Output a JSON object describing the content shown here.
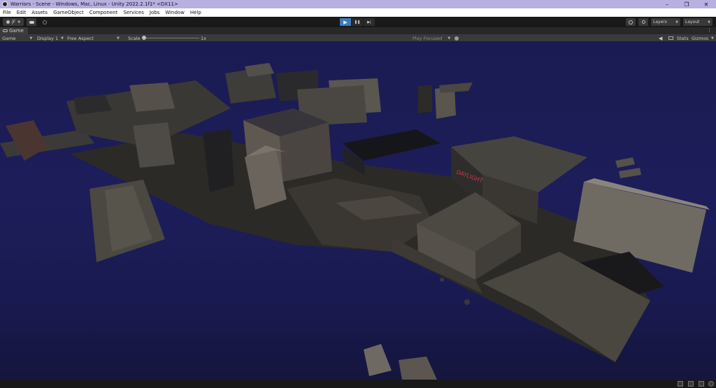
{
  "window": {
    "title": "Warriors - Scene - Windows, Mac, Linux - Unity 2022.2.1f1* <DX11>",
    "minimize": "–",
    "maximize": "❐",
    "close": "✕"
  },
  "menu": [
    "File",
    "Edit",
    "Assets",
    "GameObject",
    "Component",
    "Services",
    "Jobs",
    "Window",
    "Help"
  ],
  "toolbar": {
    "account": "JF",
    "layers": "Layers",
    "layout": "Layout",
    "play_glyph": "▶",
    "pause_glyph": "❚❚",
    "step_glyph": "▶|"
  },
  "tab": {
    "label": "Game"
  },
  "gamebar": {
    "mode": "Game",
    "display": "Display 1",
    "aspect": "Free Aspect",
    "scale_label": "Scale",
    "scale_value": "1x",
    "play_focused": "Play Focused",
    "stats": "Stats",
    "gizmos": "Gizmos"
  },
  "sign": {
    "text": "DAYLIGHT"
  },
  "colors": {
    "sky": "#1d1d5a",
    "titlebar": "#b7b0e0",
    "play_active": "#3e7ab8",
    "neon_sign": "#d0344a"
  }
}
